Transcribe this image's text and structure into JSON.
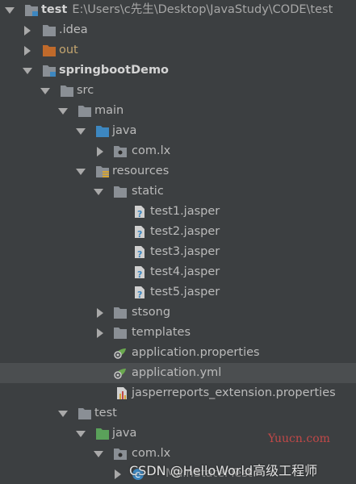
{
  "tree": {
    "root": {
      "label": "test",
      "path": "E:\\Users\\c先生\\Desktop\\JavaStudy\\CODE\\test"
    },
    "idea": ".idea",
    "out": "out",
    "module": "springbootDemo",
    "src": "src",
    "main": "main",
    "main_java": "java",
    "com_lx": "com.lx",
    "resources": "resources",
    "static": "static",
    "jaspers": [
      "test1.jasper",
      "test2.jasper",
      "test3.jasper",
      "test4.jasper",
      "test5.jasper"
    ],
    "stsong": "stsong",
    "templates": "templates",
    "app_properties": "application.properties",
    "app_yml": "application.yml",
    "jr_ext": "jasperreports_extension.properties",
    "test": "test",
    "test_java": "java",
    "test_com_lx": "com.lx",
    "main_test": "MainStaterTest"
  },
  "watermarks": {
    "site": "Yuucn.com",
    "csdn": "CSDN @HelloWorld高级工程师"
  },
  "colors": {
    "background": "#3c3f41",
    "selected_row": "#4b4e50",
    "folder": "#8a8f95",
    "source_folder": "#3d87c0",
    "test_folder": "#5aa15a",
    "out_folder": "#c06a2b",
    "spring_leaf": "#6aa84f"
  }
}
